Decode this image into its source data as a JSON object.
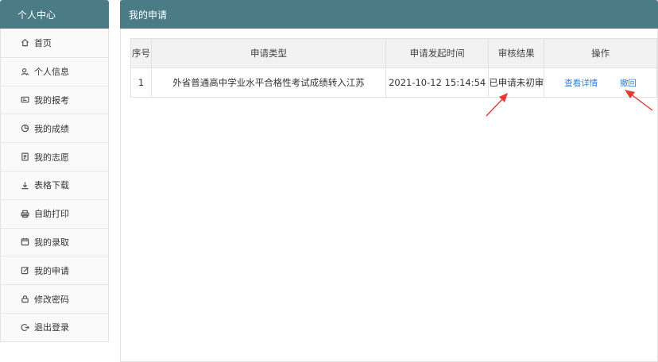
{
  "sidebar": {
    "title": "个人中心",
    "items": [
      {
        "label": "首页",
        "icon": "home-icon"
      },
      {
        "label": "个人信息",
        "icon": "user-icon"
      },
      {
        "label": "我的报考",
        "icon": "id-card-icon"
      },
      {
        "label": "我的成绩",
        "icon": "pie-chart-icon"
      },
      {
        "label": "我的志愿",
        "icon": "document-icon"
      },
      {
        "label": "表格下载",
        "icon": "download-icon"
      },
      {
        "label": "自助打印",
        "icon": "printer-icon"
      },
      {
        "label": "我的录取",
        "icon": "calendar-icon"
      },
      {
        "label": "我的申请",
        "icon": "edit-icon"
      },
      {
        "label": "修改密码",
        "icon": "lock-icon"
      },
      {
        "label": "退出登录",
        "icon": "logout-icon"
      }
    ]
  },
  "main": {
    "title": "我的申请",
    "table": {
      "headers": [
        "序号",
        "申请类型",
        "申请发起时间",
        "审核结果",
        "操作"
      ],
      "rows": [
        {
          "no": "1",
          "type": "外省普通高中学业水平合格性考试成绩转入江苏",
          "time": "2021-10-12 15:14:54",
          "result": "已申请未初审",
          "actions": [
            "查看详情",
            "撤回"
          ]
        }
      ]
    }
  },
  "colors": {
    "header_bg": "#4b7b85",
    "link": "#2f7fd8",
    "arrow": "#e53935"
  }
}
